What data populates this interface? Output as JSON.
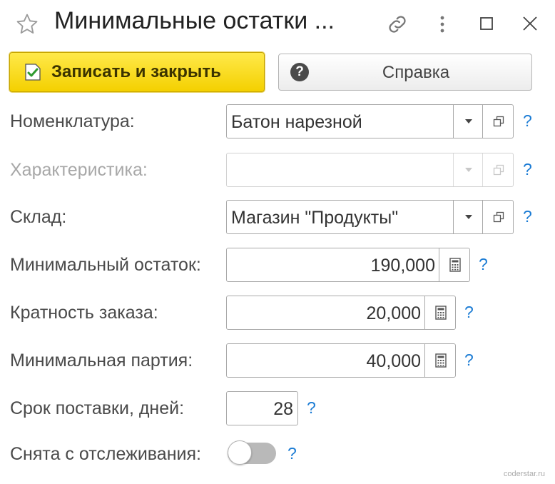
{
  "window": {
    "title": "Минимальные остатки ...",
    "icons": {
      "favorite": "star-icon",
      "link": "link-icon",
      "more": "more-vertical-icon",
      "maximize": "maximize-icon",
      "close": "close-icon"
    }
  },
  "toolbar": {
    "save_close_label": "Записать и закрыть",
    "help_label": "Справка"
  },
  "form": {
    "nomenclature": {
      "label": "Номенклатура:",
      "value": "Батон нарезной"
    },
    "characteristic": {
      "label": "Характеристика:",
      "value": ""
    },
    "warehouse": {
      "label": "Склад:",
      "value": "Магазин \"Продукты\""
    },
    "min_stock": {
      "label": "Минимальный остаток:",
      "value": "190,000"
    },
    "order_multiple": {
      "label": "Кратность заказа:",
      "value": "20,000"
    },
    "min_batch": {
      "label": "Минимальная партия:",
      "value": "40,000"
    },
    "delivery_days": {
      "label": "Срок поставки, дней:",
      "value": "28"
    },
    "untracked": {
      "label": "Снята с отслеживания:",
      "value": false
    }
  },
  "help_mark": "?",
  "watermark": "coderstar.ru",
  "colors": {
    "primary_button": "#f4d000",
    "help_link": "#1a7bd4",
    "toggle_off": "#b9b9b9"
  }
}
